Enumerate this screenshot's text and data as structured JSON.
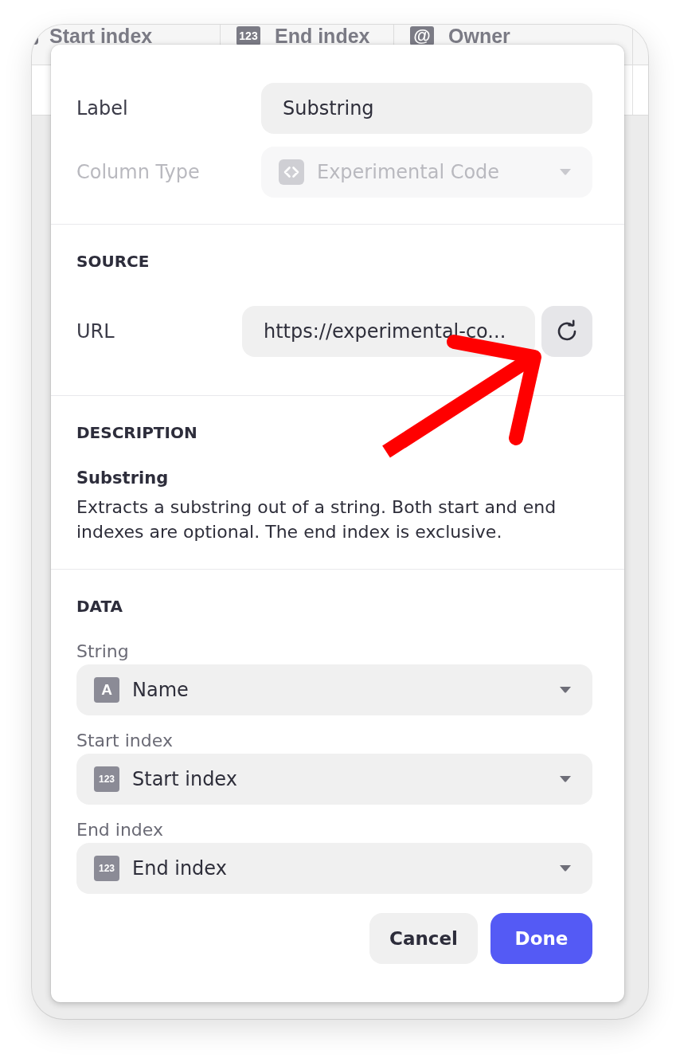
{
  "table": {
    "columns": [
      {
        "label": "Start index",
        "icon_clipped": true
      },
      {
        "label": "End index",
        "icon_clipped": false,
        "icon_glyph": "123"
      },
      {
        "label": "Owner",
        "icon_clipped": false,
        "icon_glyph": "@"
      }
    ]
  },
  "dialog": {
    "fields": [
      {
        "kind": "text",
        "label": "Label",
        "value": "Substring",
        "disabled": false
      },
      {
        "kind": "select",
        "label": "Column Type",
        "value": "Experimental Code",
        "disabled": true
      }
    ],
    "sections": [
      {
        "kind": "source",
        "heading": "SOURCE",
        "url_label": "URL",
        "url_value": "https://experimental-co..."
      },
      {
        "kind": "description",
        "heading": "DESCRIPTION",
        "title": "Substring",
        "text": "Extracts a substring out of a string. Both start and end indexes are optional. The end index is exclusive."
      },
      {
        "kind": "data",
        "heading": "DATA",
        "params": [
          {
            "label": "String",
            "value": "Name",
            "icon_glyph": "A"
          },
          {
            "label": "Start index",
            "value": "Start index",
            "icon_glyph": "123"
          },
          {
            "label": "End index",
            "value": "End index",
            "icon_glyph": "123"
          }
        ]
      }
    ],
    "buttons": [
      {
        "label": "Cancel",
        "kind": "secondary"
      },
      {
        "label": "Done",
        "kind": "primary"
      }
    ]
  },
  "annotations": [
    {
      "kind": "arrow"
    }
  ]
}
